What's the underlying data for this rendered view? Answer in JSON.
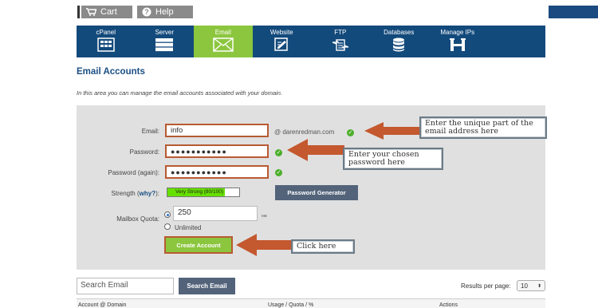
{
  "topbar": {
    "cart_label": "Cart",
    "help_label": "Help"
  },
  "nav": {
    "items": [
      {
        "label": "cPanel",
        "icon": "cpanel-icon"
      },
      {
        "label": "Server",
        "icon": "server-icon"
      },
      {
        "label": "Email",
        "icon": "email-envelope-icon",
        "active": true
      },
      {
        "label": "Website",
        "icon": "website-icon"
      },
      {
        "label": "FTP",
        "icon": "ftp-icon"
      },
      {
        "label": "Databases",
        "icon": "database-icon"
      },
      {
        "label": "Manage IPs",
        "icon": "manage-ips-icon"
      }
    ],
    "colors": {
      "bar": "#134a7c",
      "active": "#8cc63f"
    }
  },
  "page": {
    "title": "Email Accounts",
    "intro": "In this area you can manage the email accounts associated with your domain."
  },
  "form": {
    "email_label": "Email:",
    "email_value": "info",
    "domain": "@ darenredman.com",
    "password_label": "Password:",
    "password_value": "●●●●●●●●●●●",
    "password_again_label": "Password (again):",
    "password_again_value": "●●●●●●●●●●●",
    "strength_label_pre": "Strength (",
    "strength_why": "why?",
    "strength_label_post": "):",
    "strength_text": "Very Strong (80/100)",
    "strength_score": 80,
    "password_generator_label": "Password Generator",
    "quota_label": "Mailbox Quota:",
    "quota_value": "250",
    "quota_unit": "MB",
    "unlimited_label": "Unlimited",
    "create_label": "Create Account"
  },
  "callouts": {
    "email": "Enter the unique part of the email address here",
    "password": "Enter your chosen password here",
    "create": "Click here"
  },
  "list": {
    "search_placeholder": "Search Email",
    "search_button": "Search Email",
    "results_label": "Results per page:",
    "per_page": "10",
    "col_account": "Account @ Domain",
    "col_usage": "Usage / Quota / %",
    "col_actions": "Actions"
  }
}
